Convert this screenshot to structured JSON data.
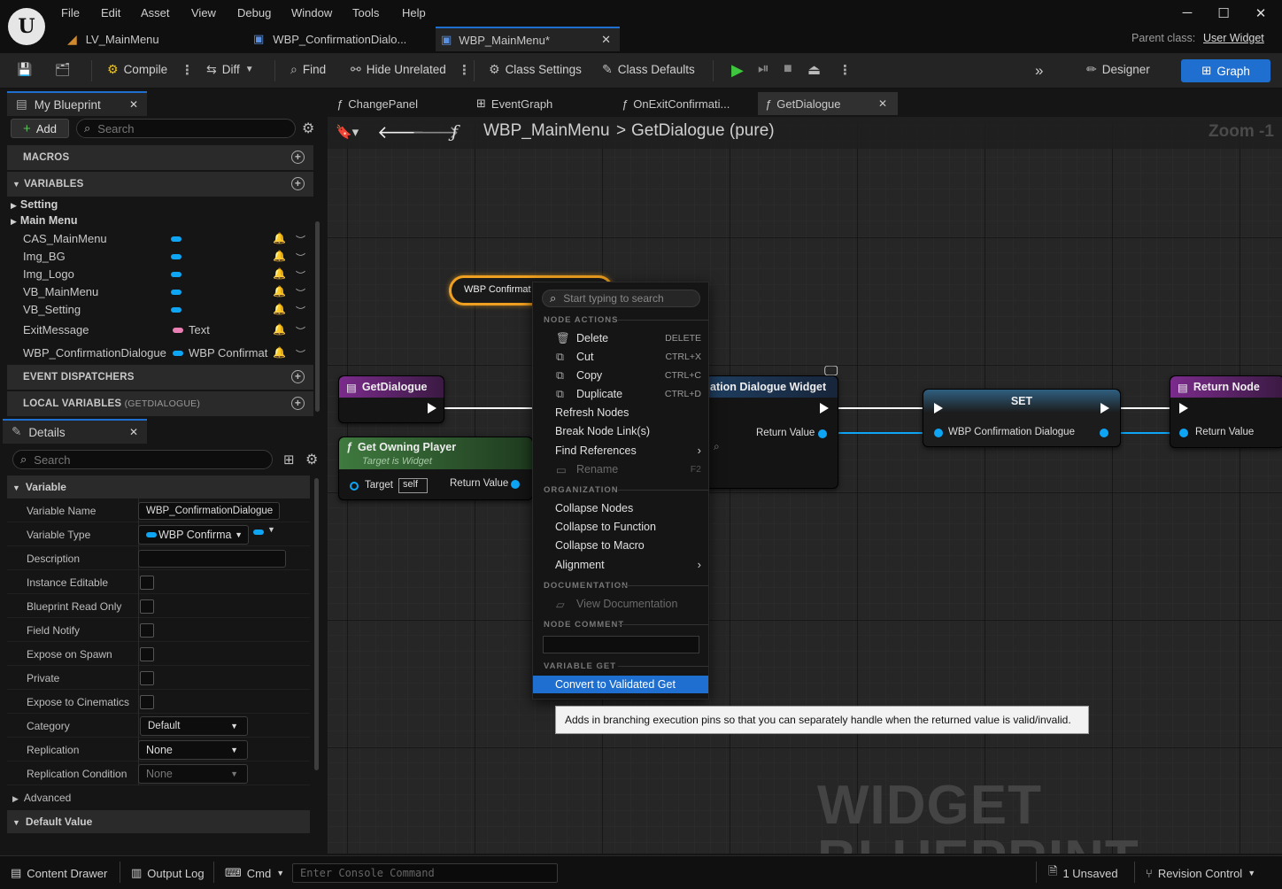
{
  "menu": [
    "File",
    "Edit",
    "Asset",
    "View",
    "Debug",
    "Window",
    "Tools",
    "Help"
  ],
  "doc_tabs": [
    {
      "label": "LV_MainMenu",
      "icon": "level-icon"
    },
    {
      "label": "WBP_ConfirmationDialo...",
      "icon": "widget-blueprint-icon"
    },
    {
      "label": "WBP_MainMenu*",
      "icon": "widget-blueprint-icon",
      "active": true
    }
  ],
  "parent_class": {
    "label": "Parent class:",
    "value": "User Widget"
  },
  "toolbar": {
    "compile": "Compile",
    "diff": "Diff",
    "find": "Find",
    "hide_unrelated": "Hide Unrelated",
    "class_settings": "Class Settings",
    "class_defaults": "Class Defaults",
    "designer": "Designer",
    "graph": "Graph"
  },
  "my_blueprint": {
    "title": "My Blueprint",
    "add": "Add",
    "search_placeholder": "Search",
    "sections": {
      "macros": "MACROS",
      "variables": "VARIABLES",
      "event_dispatchers": "EVENT DISPATCHERS",
      "local_variables": "LOCAL VARIABLES",
      "local_variables_sub": "(GETDIALOGUE)"
    },
    "categories": [
      "Setting",
      "Main Menu"
    ],
    "variables": [
      {
        "name": "CAS_MainMenu",
        "type": ""
      },
      {
        "name": "Img_BG",
        "type": ""
      },
      {
        "name": "Img_Logo",
        "type": ""
      },
      {
        "name": "VB_MainMenu",
        "type": ""
      },
      {
        "name": "VB_Setting",
        "type": ""
      },
      {
        "name": "ExitMessage",
        "type": "Text"
      },
      {
        "name": "WBP_ConfirmationDialogue",
        "type": "WBP Confirmat"
      }
    ]
  },
  "details": {
    "title": "Details",
    "search_placeholder": "Search",
    "section": "Variable",
    "variable_name_label": "Variable Name",
    "variable_name": "WBP_ConfirmationDialogue",
    "variable_type_label": "Variable Type",
    "variable_type": "WBP Confirma",
    "rows": [
      "Description",
      "Instance Editable",
      "Blueprint Read Only",
      "Field Notify",
      "Expose on Spawn",
      "Private",
      "Expose to Cinematics"
    ],
    "category_label": "Category",
    "category": "Default",
    "replication_label": "Replication",
    "replication": "None",
    "replication_condition_label": "Replication Condition",
    "replication_condition": "None",
    "advanced": "Advanced",
    "default_value": "Default Value"
  },
  "graph": {
    "tabs": [
      "ChangePanel",
      "EventGraph",
      "OnExitConfirmati...",
      "GetDialogue"
    ],
    "breadcrumb_root": "WBP_MainMenu",
    "breadcrumb_sep": ">",
    "breadcrumb_leaf": "GetDialogue (pure)",
    "zoom": "Zoom -1",
    "watermark": "WIDGET BLUEPRINT",
    "nodes": {
      "var_get": "WBP Confirmat",
      "entry": "GetDialogue",
      "get_owning_player": "Get Owning Player",
      "get_owning_player_sub": "Target is Widget",
      "target": "Target",
      "self": "self",
      "return_value": "Return Value",
      "create_widget": "ation Dialogue Widget",
      "set": "SET",
      "set_pin": "WBP Confirmation Dialogue",
      "return_node": "Return Node"
    }
  },
  "context_menu": {
    "search_placeholder": "Start typing to search",
    "cat_node_actions": "NODE ACTIONS",
    "delete": "Delete",
    "delete_key": "DELETE",
    "cut": "Cut",
    "cut_key": "CTRL+X",
    "copy": "Copy",
    "copy_key": "CTRL+C",
    "duplicate": "Duplicate",
    "duplicate_key": "CTRL+D",
    "refresh_nodes": "Refresh Nodes",
    "break_links": "Break Node Link(s)",
    "find_references": "Find References",
    "rename": "Rename",
    "rename_key": "F2",
    "cat_organization": "ORGANIZATION",
    "collapse_nodes": "Collapse Nodes",
    "collapse_function": "Collapse to Function",
    "collapse_macro": "Collapse to Macro",
    "alignment": "Alignment",
    "cat_documentation": "DOCUMENTATION",
    "view_documentation": "View Documentation",
    "cat_node_comment": "NODE COMMENT",
    "cat_variable_get": "VARIABLE GET",
    "convert_validated": "Convert to Validated Get"
  },
  "tooltip": "Adds in branching execution pins so that you can separately handle when the returned value is valid/invalid.",
  "status": {
    "content_drawer": "Content Drawer",
    "output_log": "Output Log",
    "cmd": "Cmd",
    "console_placeholder": "Enter Console Command",
    "unsaved": "1 Unsaved",
    "revision_control": "Revision Control"
  },
  "colors": {
    "accent": "#1f6fd0",
    "variable_pin": "#0ea5f5",
    "text_pin": "#e97fb3",
    "pure_func": "#3f7a3f",
    "func_entry": "#7b2b8c",
    "selection": "#f0a020"
  }
}
